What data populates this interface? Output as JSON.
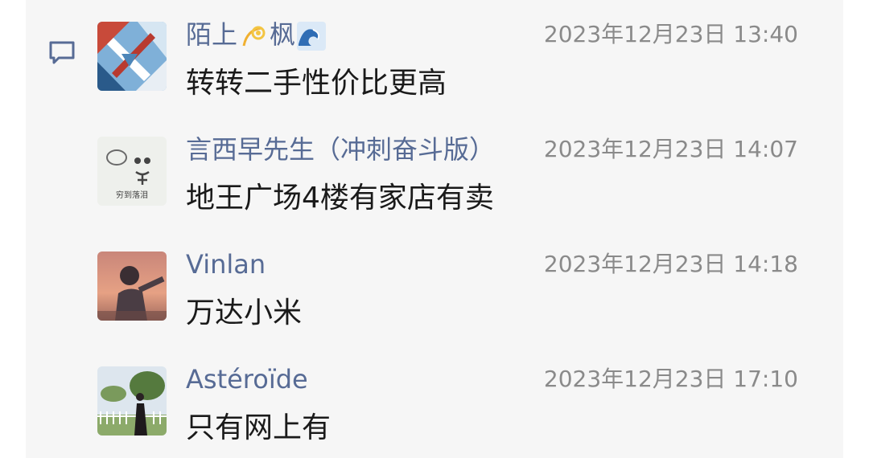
{
  "comments": [
    {
      "name_part1": "陌上",
      "name_part2": "枫",
      "time": "2023年12月23日 13:40",
      "text": "转转二手性价比更高",
      "avatar": "geometric-art-avatar"
    },
    {
      "name": "言西早先生（冲刺奋斗版）",
      "time": "2023年12月23日 14:07",
      "text": "地王广场4楼有家店有卖",
      "avatar": "cartoon-sketch-avatar",
      "avatar_caption": "穷到落泪"
    },
    {
      "name": "Vinlan",
      "time": "2023年12月23日 14:18",
      "text": "万达小米",
      "avatar": "anime-sunset-avatar"
    },
    {
      "name": "Astéroïde",
      "time": "2023年12月23日 17:10",
      "text": "只有网上有",
      "avatar": "outdoor-photo-avatar"
    }
  ]
}
